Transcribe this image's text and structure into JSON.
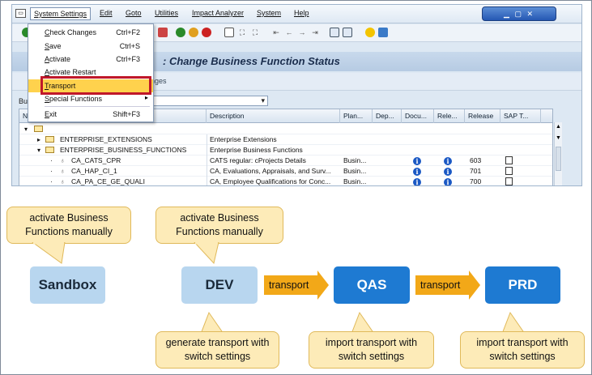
{
  "menubar": {
    "items": [
      "System Settings",
      "Edit",
      "Goto",
      "Utilities",
      "Impact Analyzer",
      "System",
      "Help"
    ]
  },
  "settings_menu": {
    "items": [
      {
        "label": "Check Changes",
        "shortcut": "Ctrl+F2"
      },
      {
        "label": "Save",
        "shortcut": "Ctrl+S"
      },
      {
        "label": "Activate",
        "shortcut": "Ctrl+F3"
      },
      {
        "label": "Activate Restart",
        "shortcut": ""
      },
      {
        "label": "Transport",
        "shortcut": ""
      },
      {
        "label": "Special Functions",
        "shortcut": ""
      },
      {
        "label": "Exit",
        "shortcut": "Shift+F3"
      }
    ]
  },
  "window": {
    "title": ": Change Business Function Status",
    "app_toolbar_text": "nges"
  },
  "filter": {
    "label": "Bu"
  },
  "grid": {
    "columns": [
      "N",
      "Description",
      "Plan...",
      "Dep...",
      "Docu...",
      "Rele...",
      "Release",
      "SAP T..."
    ],
    "rows": [
      {
        "name": "ENTERPRISE_EXTENSIONS",
        "description": "Enterprise Extensions",
        "plan": "",
        "release": ""
      },
      {
        "name": "ENTERPRISE_BUSINESS_FUNCTIONS",
        "description": "Enterprise Business Functions",
        "plan": "",
        "release": ""
      },
      {
        "name": "CA_CATS_CPR",
        "description": "CATS regular: cProjects Details",
        "plan": "Busin...",
        "release": "603"
      },
      {
        "name": "CA_HAP_CI_1",
        "description": "CA, Evaluations, Appraisals, and Surv...",
        "plan": "Busin...",
        "release": "701"
      },
      {
        "name": "CA_PA_CE_GE_QUALI",
        "description": "CA, Employee Qualifications for Conc...",
        "plan": "Busin...",
        "release": "700"
      }
    ]
  },
  "diagram": {
    "bubble_sandbox": "activate Business Functions manually",
    "bubble_dev": "activate Business Functions manually",
    "bubble_dev_bottom": "generate transport with switch settings",
    "bubble_qas_bottom": "import transport with switch settings",
    "bubble_prd_bottom": "import transport with switch settings",
    "node_sandbox": "Sandbox",
    "node_dev": "DEV",
    "node_qas": "QAS",
    "node_prd": "PRD",
    "arrow_1": "transport",
    "arrow_2": "transport"
  }
}
